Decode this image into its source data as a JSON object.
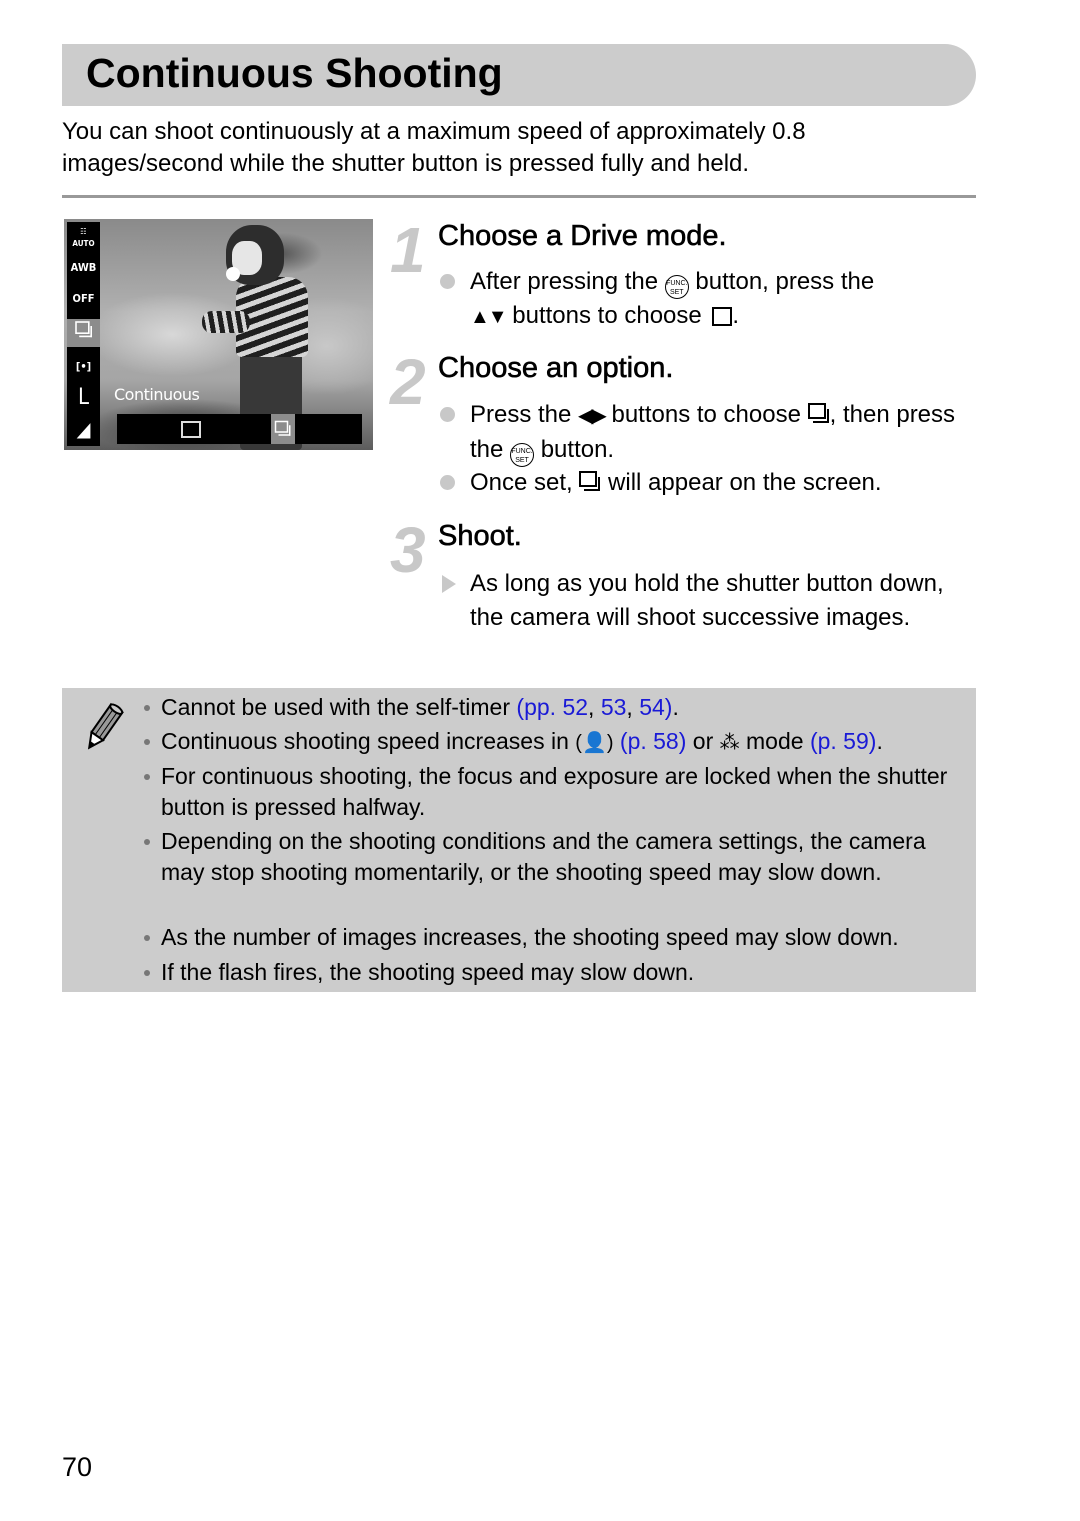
{
  "page": {
    "title": "Continuous Shooting",
    "intro": "You can shoot continuously at a maximum speed of approximately 0.8 images/second while the shutter button is pressed fully and held.",
    "page_number": "70"
  },
  "lcd": {
    "sidebar_icons": [
      {
        "name": "datetime-auto-icon",
        "label": "AUTO"
      },
      {
        "name": "white-balance-awb-icon",
        "label": "AWB"
      },
      {
        "name": "red-eye-off-icon",
        "label": "OFF"
      },
      {
        "name": "continuous-drive-icon",
        "label": "⧉",
        "selected": true
      },
      {
        "name": "metering-icon",
        "label": "[•]"
      },
      {
        "name": "image-size-large-icon",
        "label": "L"
      },
      {
        "name": "compression-icon",
        "label": "◢"
      }
    ],
    "caption": "Continuous",
    "options": [
      "single-shot",
      "continuous"
    ],
    "selected_option": "continuous"
  },
  "steps": [
    {
      "number": "1",
      "title": "Choose a Drive mode.",
      "bullets": [
        {
          "type": "dot",
          "parts": [
            "After pressing the ",
            "{FUNC}",
            " button, press the ",
            "▲▼",
            " buttons to choose ",
            "{SINGLE}",
            "."
          ]
        }
      ]
    },
    {
      "number": "2",
      "title": "Choose an option.",
      "bullets": [
        {
          "type": "dot",
          "parts": [
            "Press the ",
            "◀▶",
            " buttons to choose ",
            "{CONT}",
            ", then press the ",
            "{FUNC}",
            " button."
          ]
        },
        {
          "type": "dot",
          "parts": [
            "Once set, ",
            "{CONT}",
            " will appear on the screen."
          ]
        }
      ]
    },
    {
      "number": "3",
      "title": "Shoot.",
      "bullets": [
        {
          "type": "triangle",
          "parts": [
            "As long as you hold the shutter button down, the camera will shoot successive images."
          ]
        }
      ]
    }
  ],
  "icons": {
    "func_top": "FUNC.",
    "func_bottom": "SET",
    "up_down": "▲▼",
    "left_right": "◀▶"
  },
  "notes": {
    "icon": "pencil-icon",
    "items": [
      {
        "text_before": "Cannot be used with the self-timer ",
        "links": [
          "(pp. ",
          "52",
          ", ",
          "53",
          ", ",
          "54",
          ")"
        ],
        "text_after": "."
      },
      {
        "text_before": "Continuous shooting speed increases in ",
        "mode1_icon": "(👤)",
        "link1": "(p. 58)",
        "middle": " or ",
        "mode2_icon": "⁂",
        "text_mode": " mode ",
        "link2": "(p. 59)",
        "text_after": "."
      },
      {
        "text": "For continuous shooting, the focus and exposure are locked when the shutter button is pressed halfway."
      },
      {
        "text": "Depending on the shooting conditions and the camera settings, the camera may stop shooting momentarily, or the shooting speed may slow down."
      },
      {
        "text": "As the number of images increases, the shooting speed may slow down."
      },
      {
        "text": "If the flash fires, the shooting speed may slow down."
      }
    ]
  },
  "colors": {
    "header_bg": "#cccccc",
    "note_bg": "#cccccc",
    "link": "#1a1ad6",
    "step_number": "#c8c8c8"
  }
}
